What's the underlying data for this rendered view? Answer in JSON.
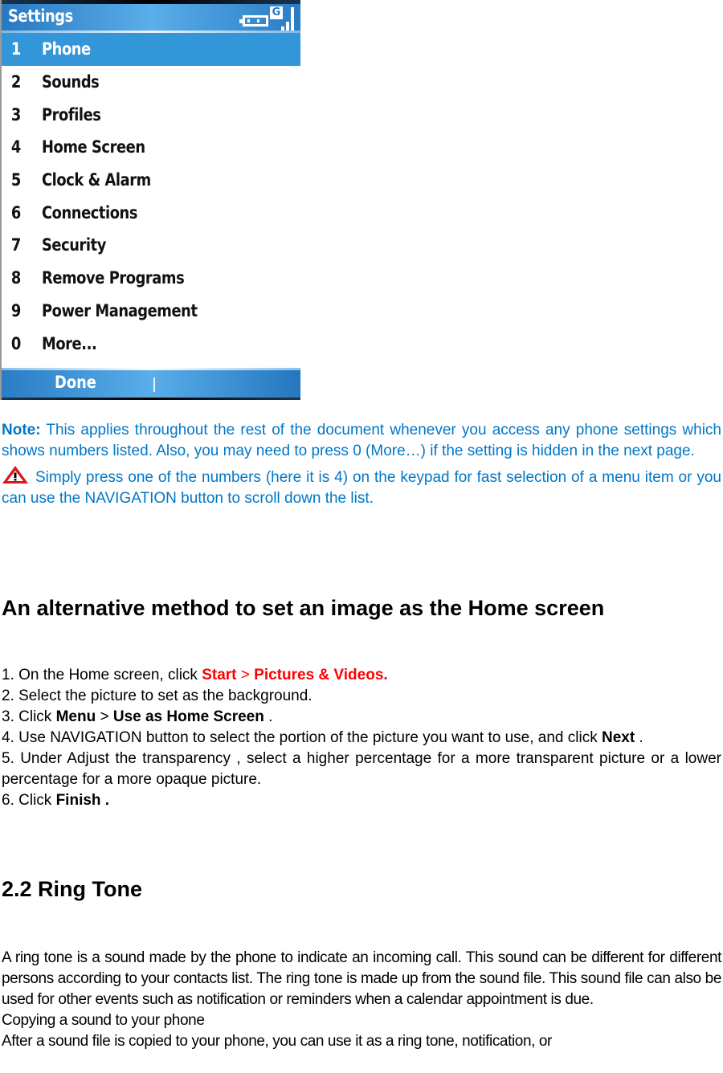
{
  "phone": {
    "title": "Settings",
    "status": {
      "network_badge": "G",
      "battery_icon": "battery-icon",
      "signal_icon": "signal-icon"
    },
    "menu_items": [
      {
        "num": "1",
        "label": "Phone",
        "selected": true
      },
      {
        "num": "2",
        "label": "Sounds"
      },
      {
        "num": "3",
        "label": "Profiles"
      },
      {
        "num": "4",
        "label": "Home Screen"
      },
      {
        "num": "5",
        "label": "Clock & Alarm"
      },
      {
        "num": "6",
        "label": "Connections"
      },
      {
        "num": "7",
        "label": "Security"
      },
      {
        "num": "8",
        "label": "Remove Programs"
      },
      {
        "num": "9",
        "label": "Power Management"
      },
      {
        "num": "0",
        "label": "More..."
      }
    ],
    "softkey_left": "Done"
  },
  "note": {
    "label": "Note:",
    "text": " This applies throughout the rest of the document whenever you access any phone settings which shows numbers listed. Also, you may need to press 0 (More…) if the setting is hidden in the next page.",
    "tip_icon": "warning-icon",
    "tip": "Simply press one of the numbers (here it is 4) on the keypad for fast selection of a menu item or you can use the NAVIGATION button to scroll down the list."
  },
  "section_alt": {
    "heading": "An alternative method to set an image as the Home screen",
    "steps": {
      "s1_prefix": "1. On the Home screen, click ",
      "s1_start": "Start",
      "s1_sep": " > ",
      "s1_target": "Pictures & Videos.",
      "s2": "2. Select the picture to set as the background.",
      "s3_prefix": "3. Click ",
      "s3_menu": "Menu",
      "s3_sep": " > ",
      "s3_target": "Use as Home Screen",
      "s3_suffix": " .",
      "s4_prefix": "4. Use NAVIGATION button to select the portion of the picture you want to use, and click ",
      "s4_next": "Next",
      "s4_suffix": " .",
      "s5": "5. Under Adjust the transparency , select a higher percentage for a more transparent picture or a lower percentage for a more opaque picture.",
      "s6_prefix": "6. Click ",
      "s6_finish": "Finish ."
    }
  },
  "section_ring": {
    "heading": "2.2 Ring Tone",
    "paragraph": "A ring tone is a sound made by the phone to indicate an incoming call. This sound can be different for different persons according to your contacts list. The ring tone is made up from the sound file. This sound file can also be used for other events such as notification or reminders when a calendar appointment is due.",
    "subheading": "Copying a sound to your phone",
    "continuation": "After a sound file is copied to your phone, you can use it as a ring tone, notification, or"
  },
  "colors": {
    "note_blue": "#0077c8",
    "highlight_red": "#ff0000",
    "phone_header_blue": "#3296d8"
  }
}
